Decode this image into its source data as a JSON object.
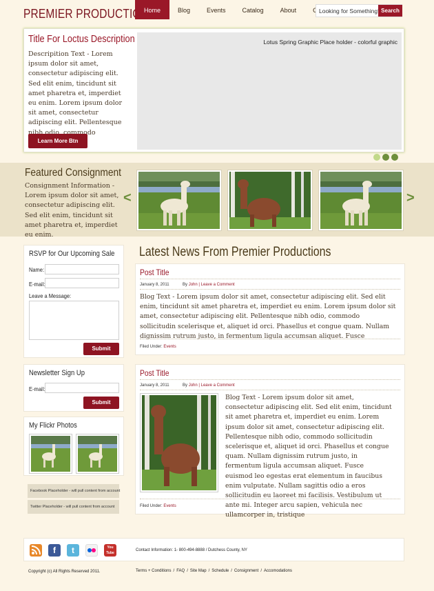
{
  "header": {
    "logo": "PREMIER PRODUCTIONS",
    "nav": [
      "Home",
      "Blog",
      "Events",
      "Catalog",
      "About",
      "Contact"
    ],
    "active_nav": "Home",
    "search_placeholder": "Looking for Something?",
    "search_button": "Search"
  },
  "hero": {
    "title": "Title For Loctus Description",
    "text": "Descripition Text - Lorem ipsum dolor sit amet, consectetur adipiscing elit. Sed elit enim, tincidunt sit amet pharetra et, imperdiet eu enim. Lorem ipsum dolor sit amet, consectetur adipiscing elit. Pellentesque nibh odio, commodo sollicitudin...",
    "button": "Learn More Btn",
    "graphic_label": "Lotus Spring Graphic Place holder - colorful graphic"
  },
  "slider_dots": {
    "count": 3,
    "active_index": 0,
    "colors": [
      "#c2d98a",
      "#6e8f3c",
      "#6e8f3c"
    ]
  },
  "featured": {
    "title": "Featured Consignment",
    "text": "Consignment Information - Lorem ipsum dolor sit amet, consectetur adipiscing elit. Sed elit enim, tincidunt sit amet pharetra et, imperdiet eu enim.",
    "prev_arrow": "<",
    "next_arrow": ">"
  },
  "rsvp": {
    "title": "RSVP for Our Upcoming Sale",
    "name_label": "Name:",
    "email_label": "E-mail:",
    "message_label": "Leave a Message:",
    "submit": "Submit"
  },
  "newsletter": {
    "title": "Newsletter Sign Up",
    "email_label": "E-mail:",
    "submit": "Submit"
  },
  "flickr": {
    "title": "My Flickr Photos"
  },
  "social_placeholders": {
    "facebook": "Facebook Placeholder - will pull content from account",
    "twitter": "Twitter Placeholder - will pull content from account"
  },
  "news": {
    "title": "Latest News From Premier Productions",
    "posts": [
      {
        "title": "Post Title",
        "date": "January 8, 2011",
        "by": "By",
        "author": "John",
        "comment": "Leave a Comment",
        "body": "Blog Text - Lorem ipsum dolor sit amet, consectetur adipiscing elit. Sed elit enim, tincidunt sit amet pharetra et, imperdiet eu enim. Lorem ipsum dolor sit amet, consectetur adipiscing elit. Pellentesque nibh odio, commodo sollicitudin scelerisque et, aliquet id orci. Phasellus et congue quam. Nullam dignissim rutrum justo, in fermentum ligula accumsan aliquet. Fusce",
        "filed_label": "Filed Under:",
        "category": "Events"
      },
      {
        "title": "Post Title",
        "date": "January 8, 2011",
        "by": "By",
        "author": "John",
        "comment": "Leave a Comment",
        "body": "Blog Text - Lorem ipsum dolor sit amet, consectetur adipiscing elit. Sed elit enim, tincidunt sit amet pharetra et, imperdiet eu enim. Lorem ipsum dolor sit amet, consectetur adipiscing elit. Pellentesque nibh odio, commodo sollicitudin scelerisque et, aliquet id orci. Phasellus et congue quam. Nullam dignissim rutrum justo, in fermentum ligula accumsan aliquet. Fusce euismod leo egestas erat elementum in faucibus enim vulputate. Nullam sagittis odio a eros sollicitudin eu laoreet mi facilisis. Vestibulum ut ante mi. Integer arcu sapien, vehicula nec ullamcorper in, tristique",
        "filed_label": "Filed Under:",
        "category": "Events"
      }
    ]
  },
  "footer": {
    "contact": "Contact Information: 1- 800-494-8888 / Dutchess County, NY",
    "copyright": "Copyright (c) All Rights Reserved 2011.",
    "links": [
      "Terms + Conditions",
      "FAQ",
      "Site Map",
      "Schedule",
      "Consignment",
      "Accomodations"
    ],
    "youtube_label": "You Tube"
  },
  "colors": {
    "brand": "#9a1828",
    "accent": "#6e8f3c",
    "background": "#fcf5e6",
    "band": "#ebe2c9"
  },
  "icons": [
    "rss-icon",
    "facebook-icon",
    "twitter-icon",
    "flickr-icon",
    "youtube-icon"
  ]
}
